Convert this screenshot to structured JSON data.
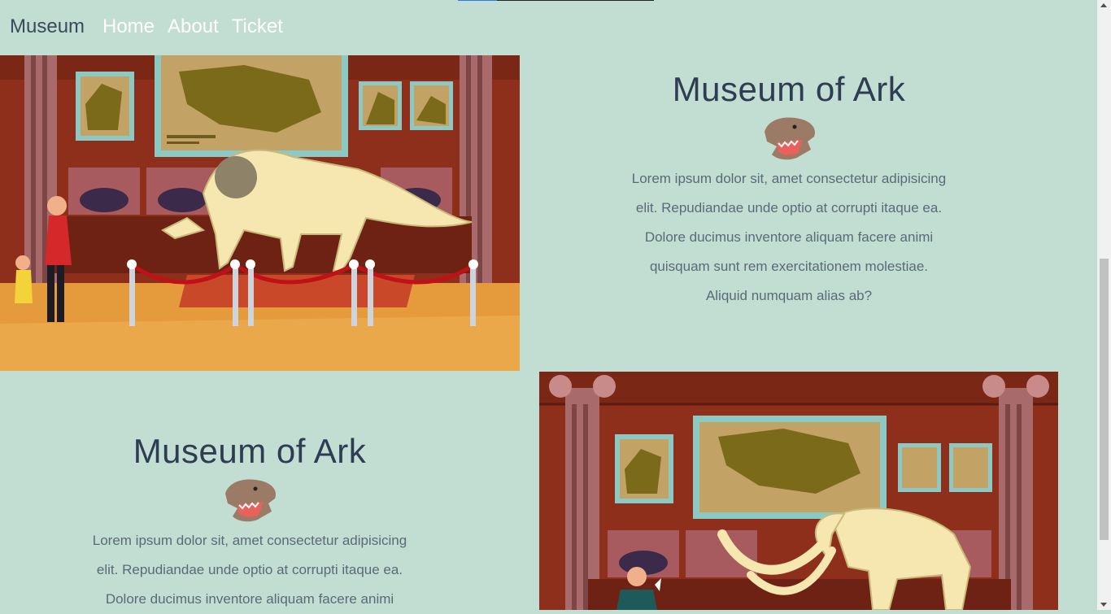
{
  "nav": {
    "brand": "Museum",
    "links": [
      "Home",
      "About",
      "Ticket"
    ]
  },
  "sections": [
    {
      "title": "Museum of Ark",
      "lines": [
        "Lorem ipsum dolor sit, amet consectetur adipisicing",
        "elit. Repudiandae unde optio at corrupti itaque ea.",
        "Dolore ducimus inventore aliquam facere animi",
        "quisquam sunt rem exercitationem molestiae.",
        "Aliquid numquam alias ab?"
      ]
    },
    {
      "title": "Museum of Ark",
      "lines": [
        "Lorem ipsum dolor sit, amet consectetur adipisicing",
        "elit. Repudiandae unde optio at corrupti itaque ea.",
        "Dolore ducimus inventore aliquam facere animi"
      ]
    }
  ],
  "colors": {
    "background": "#c2ddd2",
    "wall": "#8e2f1c",
    "floor": "#e59a3c",
    "bone": "#f6e7b0"
  }
}
